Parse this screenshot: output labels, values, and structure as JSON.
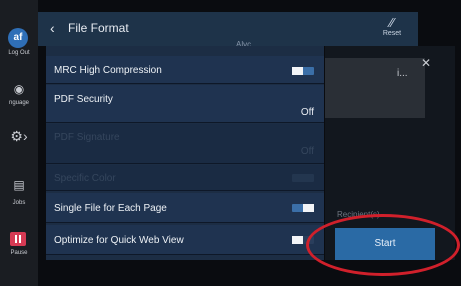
{
  "left_rail": {
    "avatar_initials": "af",
    "log_out": "Log Out",
    "language": "nguage",
    "jobs": "Jobs",
    "pause": "Pause"
  },
  "header": {
    "title": "File Format",
    "reset_label": "Reset"
  },
  "list": {
    "partial_top_text": "Alvc",
    "rows": [
      {
        "label": "MRC High Compression",
        "value": ""
      },
      {
        "label": "PDF Security",
        "value": "Off"
      },
      {
        "label": "PDF Signature",
        "value": "Off"
      },
      {
        "label": "Specific Color",
        "value": ""
      },
      {
        "label": "Single File for Each Page",
        "value": ""
      },
      {
        "label": "Optimize for Quick Web View",
        "value": ""
      }
    ]
  },
  "right_panel": {
    "more_text": "i...",
    "recipients_label": "Recipient(s)",
    "start_label": "Start"
  }
}
